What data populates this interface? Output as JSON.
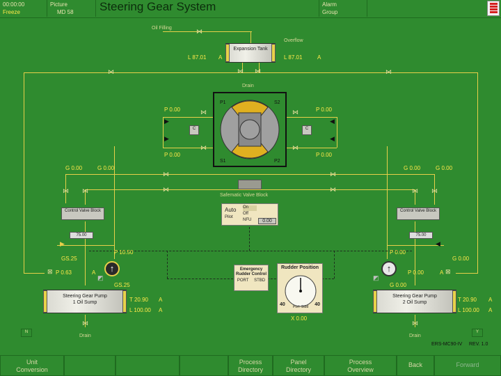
{
  "top_bar": {
    "clock": "00:00:00",
    "freeze": "Freeze",
    "picture_label": "Picture",
    "picture_value": "MD 58",
    "title": "Steering Gear System",
    "alarm": "Alarm",
    "group": "Group"
  },
  "labels": {
    "oil_filling": "Oil Filling",
    "overflow": "Overflow",
    "expansion_tank": "Expansion Tank",
    "drain_top": "Drain",
    "safematic": "Safematic Valve Block",
    "control_valve_left": "Control Valve Block",
    "control_valve_right": "Control Valve Block",
    "sump_left": "Steering Gear Pump 1 Oil Sump",
    "sump_right": "Steering Gear Pump 2 Oil Sump",
    "drain_left": "Drain",
    "drain_right": "Drain",
    "emergency": "Emergency Rudder Control",
    "emergency_port": "PORT",
    "emergency_stbd": "STBD",
    "rudder_pos_title": "Rudder Position",
    "rudder_port": "Port",
    "rudder_stbd": "Stbd",
    "rudder_left": "40",
    "rudder_right": "40",
    "p1": "P1",
    "s2": "S2",
    "s1": "S1",
    "p2": "P2",
    "auto": "Auto",
    "pilot": "Pilot",
    "ap_on": "On",
    "ap_off": "Off",
    "ap_nfu": "NFU",
    "ap_value": "0.00",
    "n_left": "N",
    "y_right": "Y",
    "model": "ERS-MC90-IV",
    "rev": "REV. 1.0"
  },
  "values": {
    "l_left": "L 87.01",
    "l_right": "L 87.01",
    "a_unit": "A",
    "p_ul": "P 0.00",
    "p_ur": "P 0.00",
    "p_ml": "P 0.00",
    "p_mr": "P 0.00",
    "g_l1": "G 0.00",
    "g_l2": "G 0.00",
    "g_r1": "G 0.00",
    "g_r2": "G 0.00",
    "press_left": "75.00",
    "press_right": "75.00",
    "p_pump1": "P 10.50",
    "p_pump2": "P 0.00",
    "gs_l1": "GS.25",
    "gs_l2": "GS.25",
    "g_r3": "G 0.00",
    "g_r4": "G 0.00",
    "dp_left": "P 0.63",
    "dp_right": "P 0.00",
    "t_left": "T 20.90",
    "l_left_sump": "L 100.00",
    "t_right": "T 20.90",
    "l_right_sump": "L 100.00",
    "x_center": "X 0.00"
  },
  "bottom_bar": [
    {
      "label": "Unit\nConversion",
      "disabled": false
    },
    {
      "label": "",
      "disabled": false
    },
    {
      "label": "",
      "disabled": false
    },
    {
      "label": "",
      "disabled": false
    },
    {
      "label": "Process\nDirectory",
      "disabled": false
    },
    {
      "label": "Panel\nDirectory",
      "disabled": false
    },
    {
      "label": "Process\nOverview",
      "disabled": false
    },
    {
      "label": "Back",
      "disabled": false
    },
    {
      "label": "Forward",
      "disabled": true
    }
  ],
  "colors": {
    "background": "#2f8b2f",
    "pipe": "#e8d04a",
    "value": "#ffe84a"
  }
}
